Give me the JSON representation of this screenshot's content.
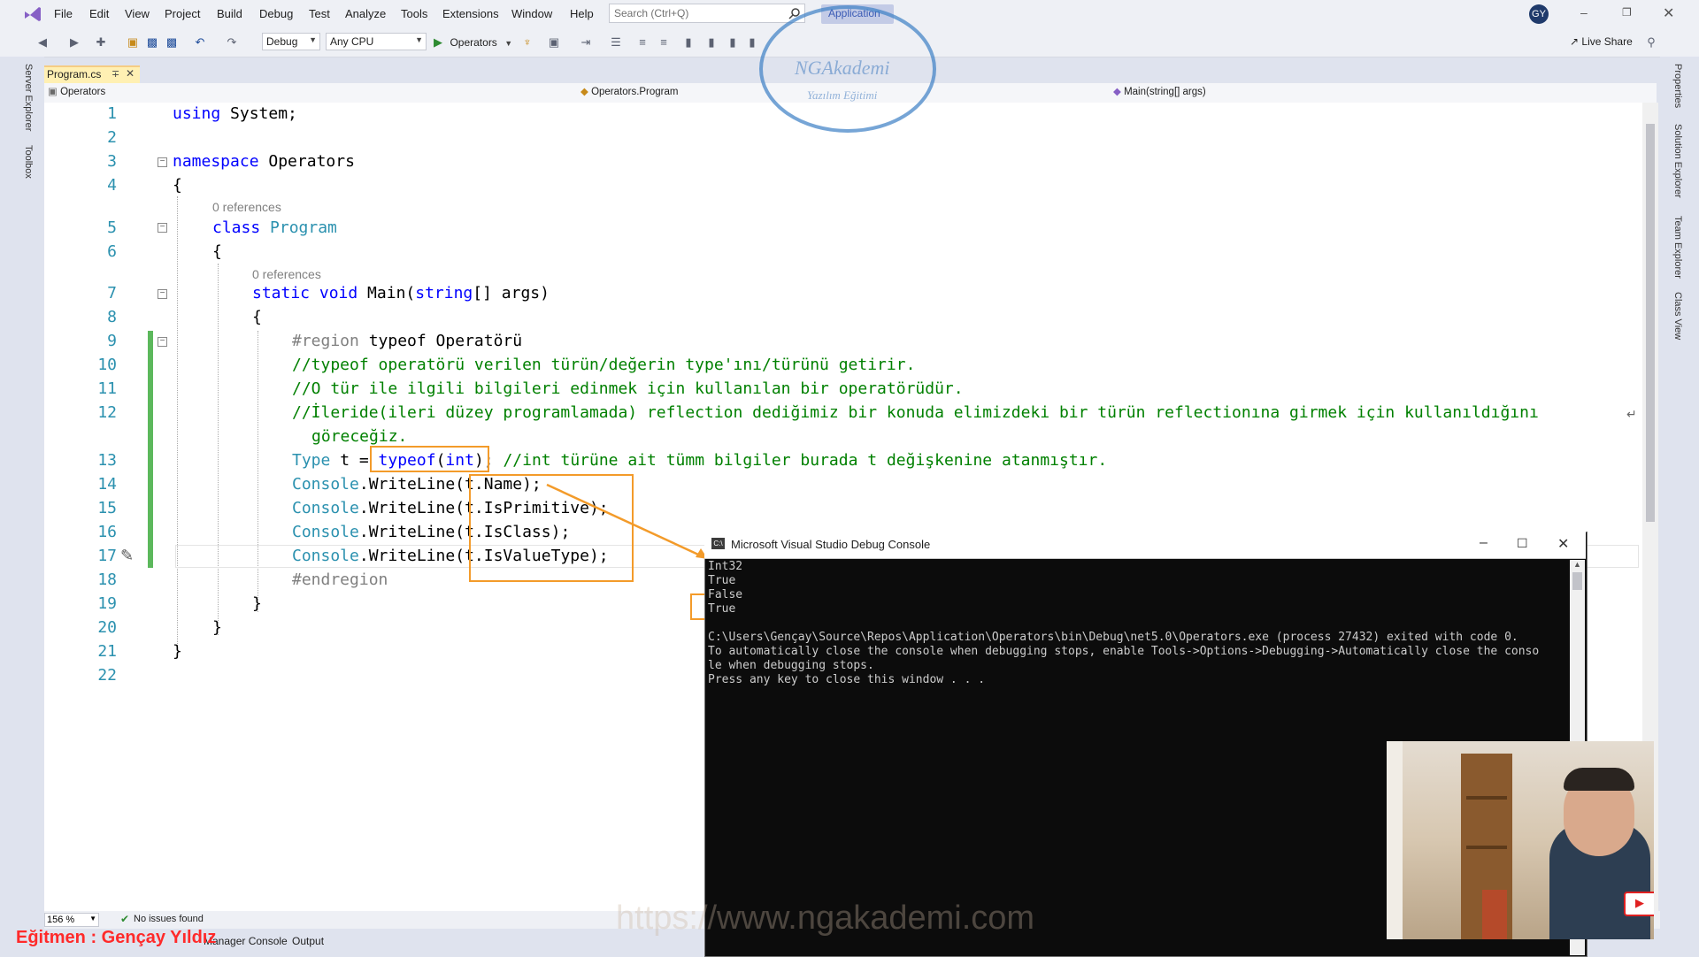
{
  "menu": {
    "items": [
      "File",
      "Edit",
      "View",
      "Project",
      "Build",
      "Debug",
      "Test",
      "Analyze",
      "Tools",
      "Extensions",
      "Window",
      "Help"
    ],
    "search_placeholder": "Search (Ctrl+Q)",
    "app_name": "Application",
    "user_initials": "GY",
    "live_share": "Live Share"
  },
  "toolbar": {
    "config": "Debug",
    "platform": "Any CPU",
    "run_target": "Operators"
  },
  "side_left": {
    "server_explorer": "Server Explorer",
    "toolbox": "Toolbox"
  },
  "side_right": {
    "properties": "Properties",
    "solution_explorer": "Solution Explorer",
    "team_explorer": "Team Explorer",
    "class_view": "Class View"
  },
  "tab": {
    "file": "Program.cs"
  },
  "nav": {
    "project": "Operators",
    "type": "Operators.Program",
    "member": "Main(string[] args)"
  },
  "editor": {
    "line_numbers": [
      "1",
      "2",
      "3",
      "4",
      "5",
      "6",
      "7",
      "8",
      "9",
      "10",
      "11",
      "12",
      "13",
      "14",
      "15",
      "16",
      "17",
      "18",
      "19",
      "20",
      "21",
      "22"
    ],
    "codelens_refs": "0 references",
    "l1_kw": "using",
    "l1_rest": " System;",
    "l3_kw": "namespace",
    "l3_rest": " Operators",
    "l4": "{",
    "l5_kw": "class",
    "l5_cls": " Program",
    "l6": "{",
    "l7_kw1": "static",
    "l7_kw2": " void",
    "l7_name": " Main(",
    "l7_kw3": "string",
    "l7_rest": "[] args)",
    "l8": "{",
    "l9_region": "#region",
    "l9_name": " typeof Operatörü",
    "l10": "//typeof operatörü verilen türün/değerin type'ını/türünü getirir.",
    "l11": "//O tür ile ilgili bilgileri edinmek için kullanılan bir operatörüdür.",
    "l12a": "//İleride(ileri düzey programlamada) reflection dediğimiz bir konuda elimizdeki bir türün reflectionına girmek için kullanıldığını",
    "l12b": "göreceğiz.",
    "l13_type": "Type",
    "l13_mid": " t = ",
    "l13_kw": "typeof",
    "l13_paren": "(",
    "l13_int": "int",
    "l13_end": ");",
    "l13_cmt": " //int türüne ait tümm bilgiler burada t değişkenine atanmıştır.",
    "console_cls": "Console",
    "writeline": ".WriteLine(",
    "l14_arg": "t.Name);",
    "l15_arg": "t.IsPrimitive);",
    "l16_arg": "t.IsClass);",
    "l17_arg": "t.IsValueType);",
    "l18": "#endregion",
    "l19": "}",
    "l20": "}",
    "l21": "}"
  },
  "status": {
    "zoom": "156 %",
    "issues": "No issues found"
  },
  "bottom_tabs": {
    "pm_console": "Manager Console",
    "output": "Output"
  },
  "console_window": {
    "title": "Microsoft Visual Studio Debug Console",
    "lines": [
      "Int32",
      "True",
      "False",
      "True",
      "",
      "C:\\Users\\Gençay\\Source\\Repos\\Application\\Operators\\bin\\Debug\\net5.0\\Operators.exe (process 27432) exited with code 0.",
      "To automatically close the console when debugging stops, enable Tools->Options->Debugging->Automatically close the conso",
      "le when debugging stops.",
      "Press any key to close this window . . ."
    ]
  },
  "overlay": {
    "watermark_line1": "NGAkademi",
    "watermark_line2": "Yazılım Eğitimi",
    "site": "https://www.ngakademi.com",
    "trainer": "Eğitmen : Gençay Yıldız"
  },
  "colors": {
    "highlight": "#f39b2a",
    "keyword": "#0000ff",
    "type": "#2b91af",
    "comment": "#008000",
    "trainer_text": "#ff2a2a"
  }
}
